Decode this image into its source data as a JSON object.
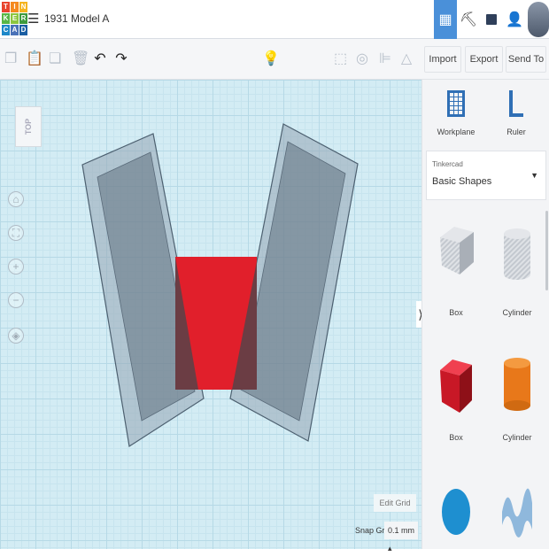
{
  "app": {
    "logo_letters": [
      "T",
      "I",
      "N",
      "K",
      "E",
      "R",
      "C",
      "A",
      "D"
    ],
    "logo_colors": [
      "#e8442e",
      "#f58a1f",
      "#f5b41f",
      "#57b646",
      "#8cc63f",
      "#3d9a3d",
      "#1e88c9",
      "#4a72b8",
      "#1a5ea3"
    ],
    "title": "1931 Model A"
  },
  "header": {
    "icons": [
      "grid-view-icon",
      "pickaxe-icon",
      "brick-icon",
      "add-user-icon",
      "avatar"
    ],
    "accent": "#4a90d9"
  },
  "toolbar": {
    "import": "Import",
    "export": "Export",
    "send_to": "Send To"
  },
  "canvas": {
    "view_cube": "TOP",
    "edit_grid": "Edit Grid",
    "snap_grid_label": "Snap Grid",
    "snap_grid_value": "0.1 mm"
  },
  "panel": {
    "workplane": "Workplane",
    "ruler": "Ruler",
    "category_group": "Tinkercad",
    "category": "Basic Shapes",
    "shapes": [
      {
        "label": "Box",
        "type": "hole"
      },
      {
        "label": "Cylinder",
        "type": "hole"
      },
      {
        "label": "Box",
        "color": "#d01e2a"
      },
      {
        "label": "Cylinder",
        "color": "#e8781a"
      },
      {
        "label": "",
        "color": "#1e8fd0"
      },
      {
        "label": "",
        "color": "#8fb8dc"
      }
    ]
  }
}
